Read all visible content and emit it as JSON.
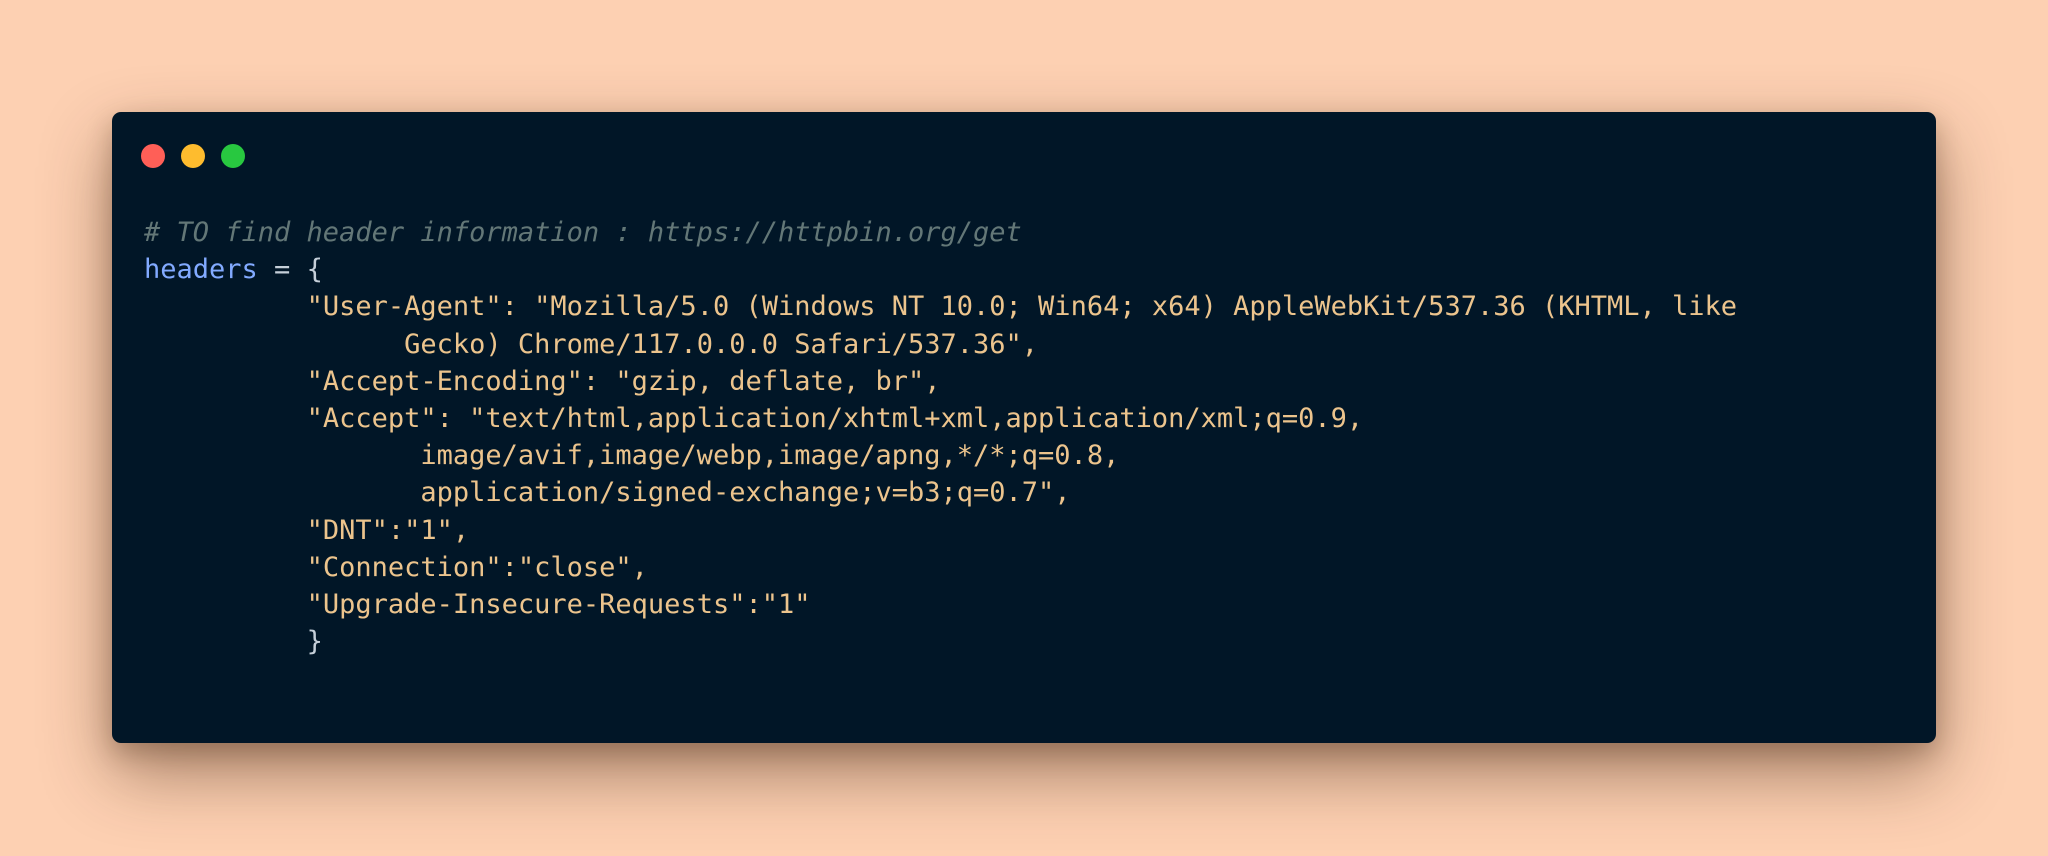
{
  "window": {
    "controls": [
      {
        "name": "close",
        "color": "#ff5f57"
      },
      {
        "name": "minimize",
        "color": "#febc2e"
      },
      {
        "name": "maximize",
        "color": "#28c840"
      }
    ]
  },
  "code": {
    "comment": "# TO find header information : https://httpbin.org/get",
    "var_name": "headers",
    "assign": " = {",
    "lines": [
      {
        "indent": "          ",
        "text": "\"User-Agent\": \"Mozilla/5.0 (Windows NT 10.0; Win64; x64) AppleWebKit/537.36 (KHTML, like"
      },
      {
        "indent": "                ",
        "text": "Gecko) Chrome/117.0.0.0 Safari/537.36\","
      },
      {
        "indent": "          ",
        "text": "\"Accept-Encoding\": \"gzip, deflate, br\","
      },
      {
        "indent": "          ",
        "text": "\"Accept\": \"text/html,application/xhtml+xml,application/xml;q=0.9,"
      },
      {
        "indent": "                 ",
        "text": "image/avif,image/webp,image/apng,*/*;q=0.8,"
      },
      {
        "indent": "                 ",
        "text": "application/signed-exchange;v=b3;q=0.7\","
      },
      {
        "indent": "          ",
        "text": "\"DNT\":\"1\","
      },
      {
        "indent": "          ",
        "text": "\"Connection\":\"close\","
      },
      {
        "indent": "          ",
        "text": "\"Upgrade-Insecure-Requests\":\"1\""
      }
    ],
    "closing_indent": "          ",
    "closing": "}"
  },
  "colors": {
    "background": "#fdd0b2",
    "editor_bg": "#011627",
    "comment": "#637777",
    "identifier": "#82aaff",
    "string": "#ecc48d"
  }
}
